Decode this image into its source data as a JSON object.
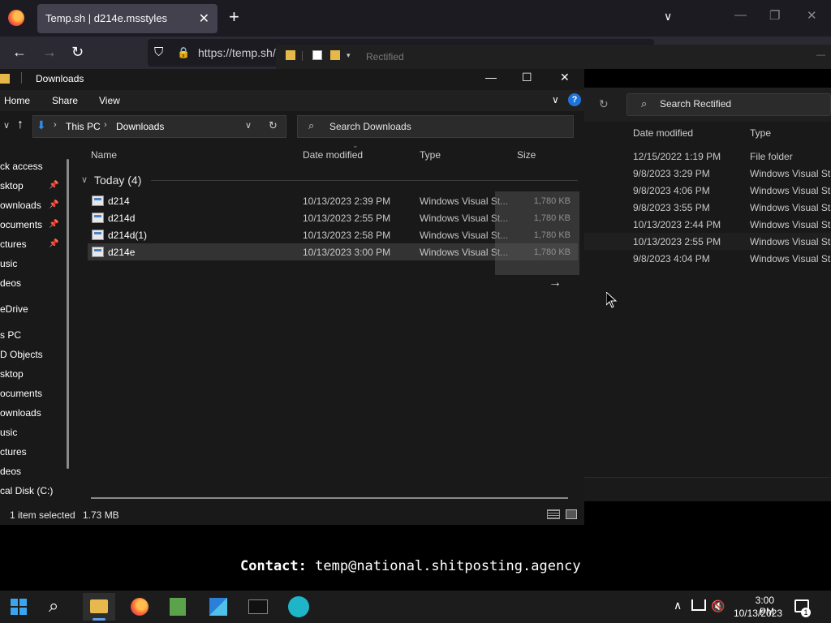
{
  "browser": {
    "tab_title": "Temp.sh | d214e.msstyles",
    "tab_close": "✕",
    "new_tab": "+",
    "list_tabs": "∨",
    "minimize": "—",
    "restore": "❐",
    "close": "✕",
    "back": "←",
    "forward": "→",
    "reload": "↻",
    "shield": "⛉",
    "lock": "🔒",
    "url": "https://temp.sh/"
  },
  "bg_explorer": {
    "title": "Rectified",
    "search_placeholder": "Search Rectified",
    "columns": {
      "date": "Date modified",
      "type": "Type"
    },
    "rows": [
      {
        "date": "12/15/2022 1:19 PM",
        "type": "File folder"
      },
      {
        "date": "9/8/2023 3:29 PM",
        "type": "Windows Visual St..."
      },
      {
        "date": "9/8/2023 4:06 PM",
        "type": "Windows Visual St..."
      },
      {
        "date": "9/8/2023 3:55 PM",
        "type": "Windows Visual St..."
      },
      {
        "date": "10/13/2023 2:44 PM",
        "type": "Windows Visual St..."
      },
      {
        "date": "10/13/2023 2:55 PM",
        "type": "Windows Visual St..."
      },
      {
        "date": "9/8/2023 4:04 PM",
        "type": "Windows Visual St..."
      }
    ]
  },
  "explorer": {
    "title": "Downloads",
    "minimize": "—",
    "maximize": "☐",
    "close": "✕",
    "ribbon": {
      "home": "Home",
      "share": "Share",
      "view": "View",
      "expand": "∨",
      "help": "?"
    },
    "address": {
      "this_pc": "This PC",
      "folder": "Downloads",
      "sep": "›",
      "drop": "∨",
      "refresh": "↻",
      "up": "↑",
      "back": "∨"
    },
    "search_placeholder": "Search Downloads",
    "nav": [
      {
        "label": "ck access",
        "pinned": false
      },
      {
        "label": "sktop",
        "pinned": true
      },
      {
        "label": "ownloads",
        "pinned": true
      },
      {
        "label": "ocuments",
        "pinned": true
      },
      {
        "label": "ctures",
        "pinned": true
      },
      {
        "label": "usic",
        "pinned": false
      },
      {
        "label": "deos",
        "pinned": false
      },
      {
        "label": "eDrive",
        "pinned": false
      },
      {
        "label": "s PC",
        "pinned": false
      },
      {
        "label": "D Objects",
        "pinned": false
      },
      {
        "label": "sktop",
        "pinned": false
      },
      {
        "label": "ocuments",
        "pinned": false
      },
      {
        "label": "ownloads",
        "pinned": false
      },
      {
        "label": "usic",
        "pinned": false
      },
      {
        "label": "ctures",
        "pinned": false
      },
      {
        "label": "deos",
        "pinned": false
      },
      {
        "label": "cal Disk (C:)",
        "pinned": false
      }
    ],
    "pin_glyph": "📌",
    "columns": {
      "name": "Name",
      "date": "Date modified",
      "type": "Type",
      "size": "Size"
    },
    "sort_glyph": "⌄",
    "group": {
      "chevron": "∨",
      "label": "Today (4)"
    },
    "files": [
      {
        "name": "d214",
        "date": "10/13/2023 2:39 PM",
        "type": "Windows Visual St...",
        "size": "1,780 KB",
        "selected": false
      },
      {
        "name": "d214d",
        "date": "10/13/2023 2:55 PM",
        "type": "Windows Visual St...",
        "size": "1,780 KB",
        "selected": false
      },
      {
        "name": "d214d(1)",
        "date": "10/13/2023 2:58 PM",
        "type": "Windows Visual St...",
        "size": "1,780 KB",
        "selected": false
      },
      {
        "name": "d214e",
        "date": "10/13/2023 3:00 PM",
        "type": "Windows Visual St...",
        "size": "1,780 KB",
        "selected": true
      }
    ],
    "overlay_arrow": "→",
    "status": {
      "selected": "1 item selected",
      "size": "1.73 MB"
    }
  },
  "contact": {
    "label": "Contact:",
    "email": "temp@national.shitposting.agency"
  },
  "taskbar": {
    "search_glyph": "⌕",
    "tray_chevron": "∧",
    "volume_glyph": "🔇",
    "time": "3:00 PM",
    "date": "10/13/2023",
    "notif_count": "1"
  }
}
